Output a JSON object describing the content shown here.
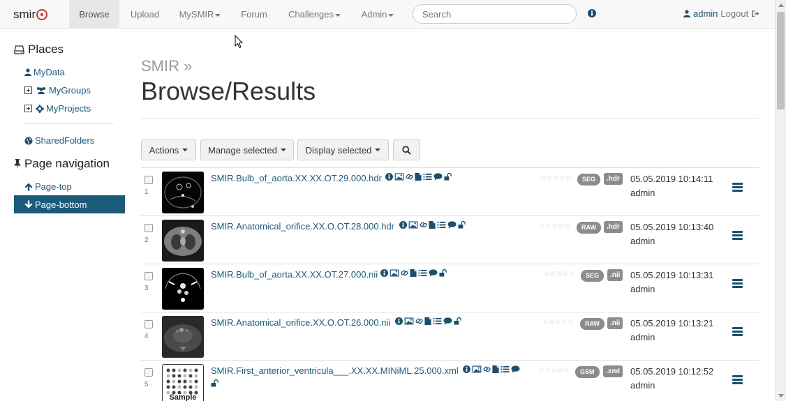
{
  "brand": {
    "name": "smir"
  },
  "nav": {
    "browse": "Browse",
    "upload": "Upload",
    "mysmir": "MySMIR",
    "forum": "Forum",
    "challenges": "Challenges",
    "admin": "Admin",
    "search_placeholder": "Search",
    "user": "admin",
    "logout": "Logout"
  },
  "sidebar": {
    "places_heading": "Places",
    "mydata": "MyData",
    "mygroups": "MyGroups",
    "myprojects": "MyProjects",
    "sharedfolders": "SharedFolders",
    "pagenav_heading": "Page navigation",
    "page_top": "Page-top",
    "page_bottom": "Page-bottom"
  },
  "main": {
    "breadcrumb": "SMIR »",
    "title": "Browse/Results",
    "actions": "Actions",
    "manage_selected": "Manage selected",
    "display_selected": "Display selected"
  },
  "colors": {
    "accent": "#1c5a7a",
    "badge": "#8c8c8c"
  },
  "results": [
    {
      "num": "1",
      "name": "SMIR.Bulb_of_aorta.XX.XX.OT.29.000.hdr",
      "modality": "SEG",
      "type": ".hdr",
      "date": "05.05.2019 10:14:11",
      "owner": "admin"
    },
    {
      "num": "2",
      "name": "SMIR.Anatomical_orifice.XX.O.OT.28.000.hdr",
      "modality": "RAW",
      "type": ".hdr",
      "date": "05.05.2019 10:13:40",
      "owner": "admin"
    },
    {
      "num": "3",
      "name": "SMIR.Bulb_of_aorta.XX.XX.OT.27.000.nii",
      "modality": "SEG",
      "type": ".nii",
      "date": "05.05.2019 10:13:31",
      "owner": "admin"
    },
    {
      "num": "4",
      "name": "SMIR.Anatomical_orifice.XX.O.OT.26.000.nii",
      "modality": "RAW",
      "type": ".nii",
      "date": "05.05.2019 10:13:21",
      "owner": "admin"
    },
    {
      "num": "5",
      "name": "SMIR.First_anterior_ventricula___.XX.XX.MINiML.25.000.xml",
      "modality": "GSM",
      "type": ".xml",
      "date": "05.05.2019 10:12:52",
      "owner": "admin",
      "thumb_text": "Sample"
    }
  ]
}
